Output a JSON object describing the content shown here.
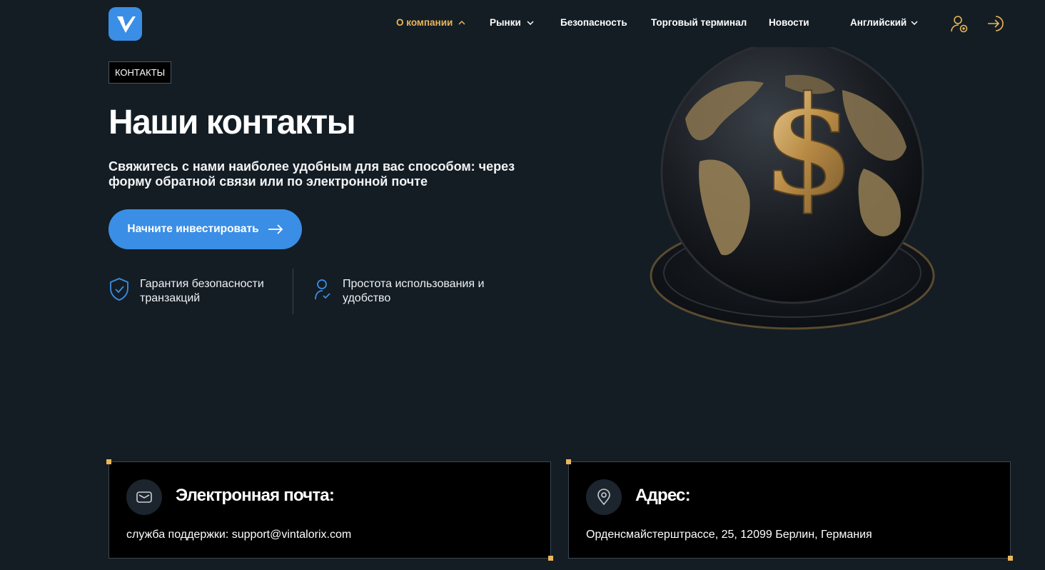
{
  "header": {
    "logo_icon": "v-check-logo-icon",
    "nav": [
      {
        "label": "О компании",
        "has_dropdown": true,
        "active": true
      },
      {
        "label": "Рынки",
        "has_dropdown": true,
        "active": false
      },
      {
        "label": "Безопасность",
        "has_dropdown": false,
        "active": false
      },
      {
        "label": "Торговый терминал",
        "has_dropdown": false,
        "active": false
      },
      {
        "label": "Новости",
        "has_dropdown": false,
        "active": false
      }
    ],
    "language": "Английский",
    "icons": [
      "user-add-icon",
      "login-icon"
    ]
  },
  "hero": {
    "tag": "КОНТАКТЫ",
    "title": "Наши контакты",
    "subtitle": "Свяжитесь с нами наиболее удобным для вас способом: через форму обратной связи или по электронной почте",
    "cta_label": "Начните инвестировать",
    "features": [
      {
        "icon": "shield-check-icon",
        "text": "Гарантия безопасности транзакций"
      },
      {
        "icon": "user-check-icon",
        "text": "Простота использования и удобство"
      }
    ],
    "image": "globe-dollar-image"
  },
  "cards": [
    {
      "icon": "mail-icon",
      "title": "Электронная почта:",
      "text": "служба поддержки: support@vintalorix.com"
    },
    {
      "icon": "location-pin-icon",
      "title": "Адрес:",
      "text": "Орденсмайстерштрассе, 25, 12099 Берлин, Германия"
    }
  ],
  "colors": {
    "background": "#141d24",
    "accent": "#3a8ee6",
    "highlight": "#e9b65a",
    "card_bg": "#000000"
  }
}
